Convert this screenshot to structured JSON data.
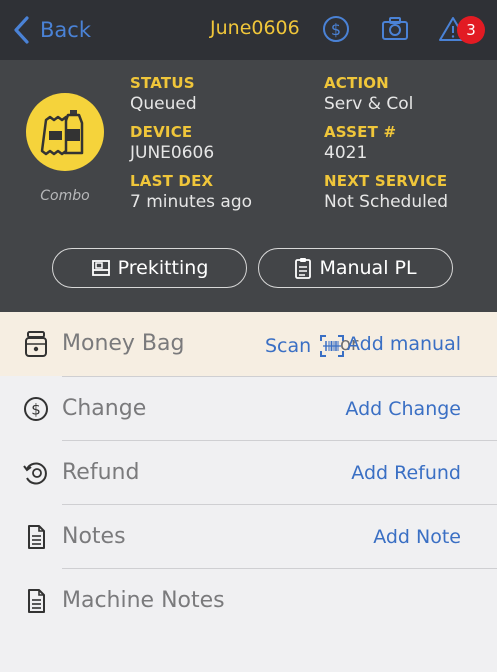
{
  "nav": {
    "back_label": "Back",
    "title": "June0606",
    "alert_count": "3",
    "accent": "#f0c63a",
    "link_color": "#4a82d6"
  },
  "machine": {
    "type_label": "Combo",
    "icon": "snack-bottle-icon",
    "circle_color": "#f5d33b",
    "status_label": "STATUS",
    "status_value": "Queued",
    "action_label": "ACTION",
    "action_value": "Serv & Col",
    "device_label": "DEVICE",
    "device_value": "JUNE0606",
    "asset_label": "ASSET #",
    "asset_value": "4021",
    "last_dex_label": "LAST DEX",
    "last_dex_value": "7 minutes ago",
    "next_service_label": "NEXT SERVICE",
    "next_service_value": "Not Scheduled"
  },
  "buttons": {
    "prekitting": "Prekitting",
    "manual_pl": "Manual PL"
  },
  "list": {
    "money_bag": {
      "label": "Money Bag",
      "scan": "Scan",
      "or": "or",
      "action": "Add manual"
    },
    "change": {
      "label": "Change",
      "action": "Add Change"
    },
    "refund": {
      "label": "Refund",
      "action": "Add Refund"
    },
    "notes": {
      "label": "Notes",
      "action": "Add Note"
    },
    "machine_notes": {
      "label": "Machine Notes"
    }
  }
}
